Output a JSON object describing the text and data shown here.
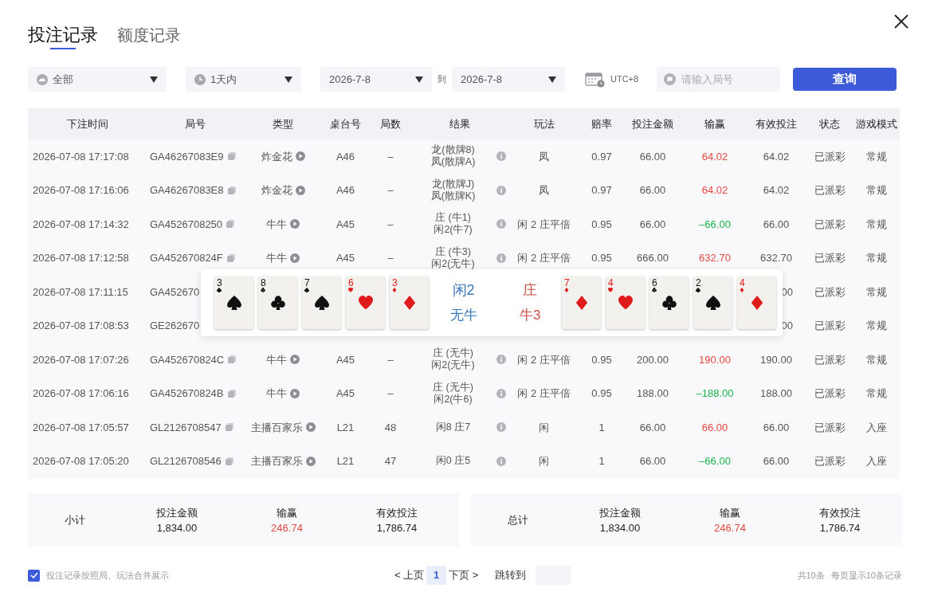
{
  "tabs": [
    {
      "label": "投注记录",
      "selected": true
    },
    {
      "label": "额度记录",
      "selected": false
    }
  ],
  "filters": {
    "category": "全部",
    "period": "1天内",
    "date_from": "2026-7-8",
    "to_label": "到",
    "date_to": "2026-7-8",
    "timezone": "UTC+8",
    "search_placeholder": "请输入局号",
    "query_button": "查询"
  },
  "table": {
    "columns": [
      "下注时间",
      "局号",
      "类型",
      "桌台号",
      "局数",
      "结果",
      "玩法",
      "赔率",
      "投注金额",
      "输赢",
      "有效投注",
      "状态",
      "游戏模式"
    ],
    "rows": [
      {
        "kind": "full",
        "time": "2026-07-08 17:17:08",
        "round_id": "GA46267083E9",
        "game": "炸金花",
        "table": "A46",
        "round": "–",
        "result": [
          "龙(散牌8)",
          "凤(散牌A)"
        ],
        "play": "凤",
        "odds": "0.97",
        "bet": "66.00",
        "win_loss": "64.02",
        "color": "#e4473f",
        "effective": "64.02",
        "status": "已派彩",
        "mode": "常规"
      },
      {
        "kind": "full",
        "time": "2026-07-08 17:16:06",
        "round_id": "GA46267083E8",
        "game": "炸金花",
        "table": "A46",
        "round": "–",
        "result": [
          "龙(散牌J)",
          "凤(散牌K)"
        ],
        "play": "凤",
        "odds": "0.97",
        "bet": "66.00",
        "win_loss": "64.02",
        "color": "#e4473f",
        "effective": "64.02",
        "status": "已派彩",
        "mode": "常规"
      },
      {
        "kind": "full",
        "time": "2026-07-08 17:14:32",
        "round_id": "GA4526708250",
        "game": "牛牛",
        "table": "A45",
        "round": "–",
        "result": [
          "庄 (牛1)",
          "闲2(牛7)"
        ],
        "play": "闲 2 庄平倍",
        "odds": "0.95",
        "bet": "66.00",
        "win_loss": "–66.00",
        "color": "#19b34c",
        "effective": "66.00",
        "status": "已派彩",
        "mode": "常规"
      },
      {
        "kind": "full",
        "time": "2026-07-08 17:12:58",
        "round_id": "GA452670824F",
        "game": "牛牛",
        "table": "A45",
        "round": "–",
        "result": [
          "庄 (牛3)",
          "闲2(无牛)"
        ],
        "play": "闲 2 庄平倍",
        "odds": "0.95",
        "bet": "666.00",
        "win_loss": "632.70",
        "color": "#e4473f",
        "effective": "632.70",
        "status": "已派彩",
        "mode": "常规"
      },
      {
        "kind": "covered",
        "time": "2026-07-08 17:11:15",
        "round_id": "GA452670",
        "effective": "00",
        "status": "已派彩",
        "mode": "常规"
      },
      {
        "kind": "covered",
        "time": "2026-07-08 17:08:53",
        "round_id": "GE262670",
        "effective": "00",
        "status": "已派彩",
        "mode": "常规"
      },
      {
        "kind": "full",
        "time": "2026-07-08 17:07:26",
        "round_id": "GA452670824C",
        "game": "牛牛",
        "table": "A45",
        "round": "–",
        "result": [
          "庄 (无牛)",
          "闲2(无牛)"
        ],
        "play": "闲 2 庄平倍",
        "odds": "0.95",
        "bet": "200.00",
        "win_loss": "190.00",
        "color": "#e4473f",
        "effective": "190.00",
        "status": "已派彩",
        "mode": "常规"
      },
      {
        "kind": "full",
        "time": "2026-07-08 17:06:16",
        "round_id": "GA452670824B",
        "game": "牛牛",
        "table": "A45",
        "round": "–",
        "result": [
          "庄 (无牛)",
          "闲2(牛6)"
        ],
        "play": "闲 2 庄平倍",
        "odds": "0.95",
        "bet": "188.00",
        "win_loss": "–188.00",
        "color": "#19b34c",
        "effective": "188.00",
        "status": "已派彩",
        "mode": "常规"
      },
      {
        "kind": "full",
        "time": "2026-07-08 17:05:57",
        "round_id": "GL2126708547",
        "game": "主播百家乐",
        "table": "L21",
        "round": "48",
        "result": [
          "闲8 庄7"
        ],
        "play": "闲",
        "odds": "1",
        "bet": "66.00",
        "win_loss": "66.00",
        "color": "#e4473f",
        "effective": "66.00",
        "status": "已派彩",
        "mode": "入座"
      },
      {
        "kind": "full",
        "time": "2026-07-08 17:05:20",
        "round_id": "GL2126708546",
        "game": "主播百家乐",
        "table": "L21",
        "round": "47",
        "result": [
          "闲0 庄5"
        ],
        "play": "闲",
        "odds": "1",
        "bet": "66.00",
        "win_loss": "–66.00",
        "color": "#19b34c",
        "effective": "66.00",
        "status": "已派彩",
        "mode": "入座"
      }
    ]
  },
  "popover": {
    "left_cards": [
      {
        "rank": "3",
        "kind": "spade"
      },
      {
        "rank": "8",
        "kind": "club"
      },
      {
        "rank": "7",
        "kind": "spade"
      },
      {
        "rank": "6",
        "kind": "heart"
      },
      {
        "rank": "3",
        "kind": "diamond"
      }
    ],
    "hands": [
      {
        "name": "闲2",
        "score": "无牛",
        "color": "#3a78b8"
      },
      {
        "name": "庄",
        "score": "牛3",
        "color": "#c9514a"
      }
    ],
    "right_cards": [
      {
        "rank": "7",
        "kind": "diamond"
      },
      {
        "rank": "4",
        "kind": "heart"
      },
      {
        "rank": "6",
        "kind": "club"
      },
      {
        "rank": "2",
        "kind": "spade"
      },
      {
        "rank": "4",
        "kind": "diamond"
      }
    ]
  },
  "summaries": [
    {
      "label": "小计",
      "stats": [
        {
          "label": "投注金额",
          "value": "1,834.00"
        },
        {
          "label": "输赢",
          "value": "246.74",
          "color": "#e4473f"
        },
        {
          "label": "有效投注",
          "value": "1,786.74"
        }
      ]
    },
    {
      "label": "总计",
      "stats": [
        {
          "label": "投注金额",
          "value": "1,834.00"
        },
        {
          "label": "输赢",
          "value": "246.74",
          "color": "#e4473f"
        },
        {
          "label": "有效投注",
          "value": "1,786.74"
        }
      ]
    }
  ],
  "footer": {
    "merge_checkbox": {
      "label": "投注记录按照局、玩法合并展示",
      "checked": true
    },
    "prev": "< 上页",
    "pages": [
      {
        "label": "1",
        "selected": true
      }
    ],
    "next": "下页 >",
    "jump_label": "跳转到",
    "total": "共10条",
    "per_page": "每页显示10条记录"
  }
}
